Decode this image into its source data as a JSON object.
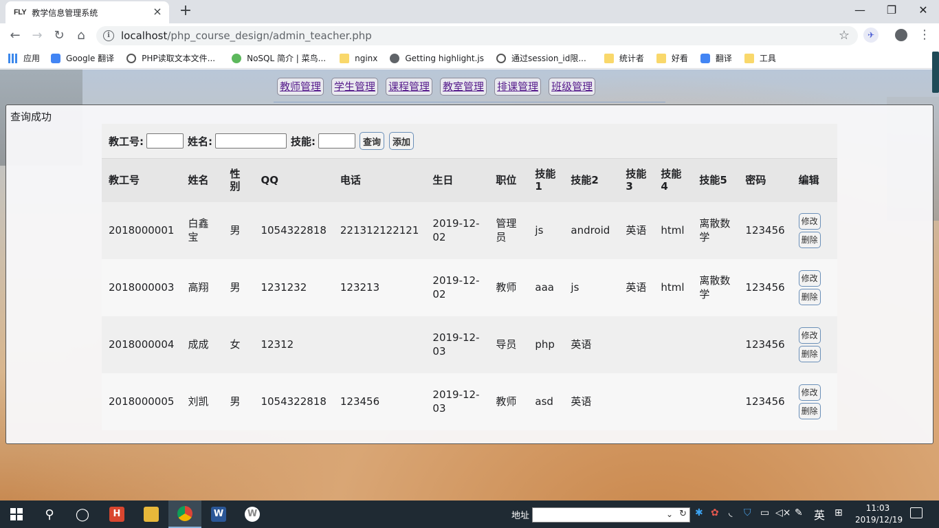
{
  "browser": {
    "tab": {
      "favicon": "FLY",
      "title": "教学信息管理系统",
      "close": "×"
    },
    "new_tab": "+",
    "window_controls": {
      "minimize": "—",
      "maximize": "❐",
      "close": "✕"
    },
    "address": {
      "host": "localhost",
      "path": "/php_course_design/admin_teacher.php"
    },
    "bookmarks": [
      {
        "label": "应用",
        "icon": "apps-grid-icon"
      },
      {
        "label": "Google 翻译",
        "icon": "google-translate-icon"
      },
      {
        "label": "PHP读取文本文件...",
        "icon": "fx-icon"
      },
      {
        "label": "NoSQL 简介 | 菜鸟...",
        "icon": "runoob-icon"
      },
      {
        "label": "nginx",
        "icon": "folder-icon"
      },
      {
        "label": "Getting highlight.js",
        "icon": "globe-icon"
      },
      {
        "label": "通过session_id限...",
        "icon": "fx-icon"
      },
      {
        "label": "统计者",
        "icon": "folder-icon"
      },
      {
        "label": "好看",
        "icon": "folder-icon"
      },
      {
        "label": "翻译",
        "icon": "google-translate-icon"
      },
      {
        "label": "工具",
        "icon": "folder-icon"
      }
    ]
  },
  "nav": {
    "items": [
      "教师管理",
      "学生管理",
      "课程管理",
      "教室管理",
      "排课管理",
      "班级管理"
    ]
  },
  "status": "查询成功",
  "search": {
    "id_label": "教工号:",
    "name_label": "姓名:",
    "skill_label": "技能:",
    "id_value": "",
    "name_value": "",
    "skill_value": "",
    "query_button": "查询",
    "add_button": "添加"
  },
  "table": {
    "headers": [
      "教工号",
      "姓名",
      "性别",
      "QQ",
      "电话",
      "生日",
      "职位",
      "技能1",
      "技能2",
      "技能3",
      "技能4",
      "技能5",
      "密码",
      "编辑"
    ],
    "edit_label": "修改",
    "delete_label": "删除",
    "rows": [
      [
        "2018000001",
        "白鑫宝",
        "男",
        "1054322818",
        "221312122121",
        "2019-12-02",
        "管理员",
        "js",
        "android",
        "英语",
        "html",
        "离散数学",
        "123456"
      ],
      [
        "2018000003",
        "高翔",
        "男",
        "1231232",
        "123213",
        "2019-12-02",
        "教师",
        "aaa",
        "js",
        "英语",
        "html",
        "离散数学",
        "123456"
      ],
      [
        "2018000004",
        "成成",
        "女",
        "12312",
        "",
        "2019-12-03",
        "导员",
        "php",
        "英语",
        "",
        "",
        "",
        "123456"
      ],
      [
        "2018000005",
        "刘凯",
        "男",
        "1054322818",
        "123456",
        "2019-12-03",
        "教师",
        "asd",
        "英语",
        "",
        "",
        "",
        "123456"
      ]
    ]
  },
  "taskbar": {
    "address_label": "地址",
    "ime": "英",
    "time": "11:03",
    "date": "2019/12/19",
    "word_icon": "W",
    "huawei_icon": "H"
  }
}
